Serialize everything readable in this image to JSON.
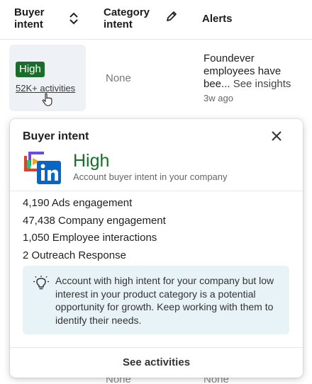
{
  "table": {
    "headers": {
      "buyer_intent": "Buyer intent",
      "category_intent": "Category intent",
      "alerts": "Alerts"
    },
    "row": {
      "intent_badge": "High",
      "activities_link": "52K+ activities",
      "category": "None",
      "alert_text": "Foundever employees have bee...",
      "alert_link": "See insights",
      "alert_time": "3w ago"
    },
    "next_row": {
      "category": "None",
      "alert": "None"
    }
  },
  "popup": {
    "title": "Buyer intent",
    "level": "High",
    "subtitle": "Account buyer intent in your company",
    "stats": [
      "4,190 Ads engagement",
      "47,438 Company engagement",
      "1,050 Employee interactions",
      "2 Outreach Response"
    ],
    "note": "Account with high intent for your company but low interest in your product category is a potential opportunity for growth. Keep working with them to identify their needs.",
    "footer_button": "See activities"
  },
  "colors": {
    "high_green": "#1a6d2a",
    "note_bg": "#e8f3f8",
    "linkedin_blue": "#0a66c2"
  },
  "icons": [
    "sort-icon",
    "pencil-icon",
    "cursor-icon",
    "close-icon",
    "linkedin-logo",
    "lightbulb-icon"
  ]
}
